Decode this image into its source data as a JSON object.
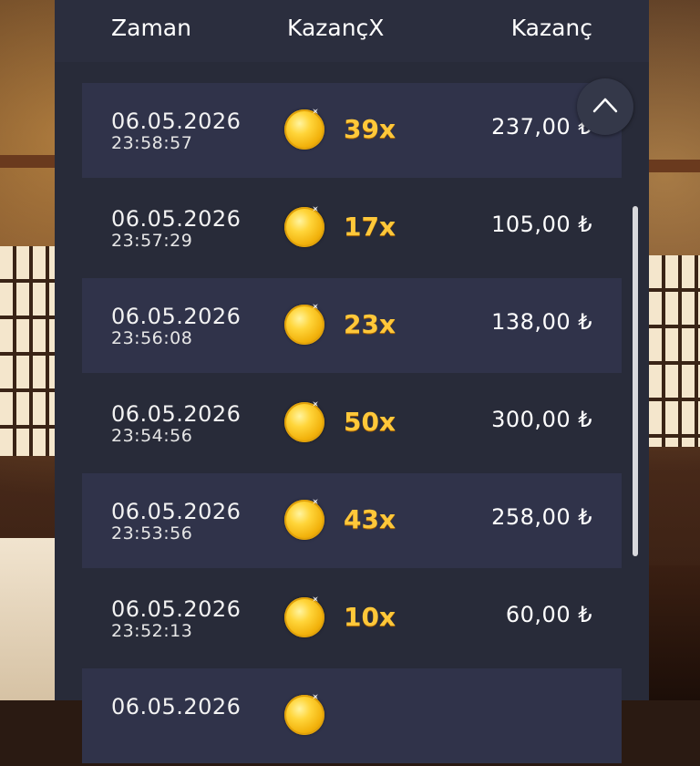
{
  "header": {
    "time_label": "Zaman",
    "multiplier_label": "KazançX",
    "win_label": "Kazanç"
  },
  "rows": [
    {
      "date": "06.05.2026",
      "time": "23:58:57",
      "multiplier": "39x",
      "amount": "237,00 ₺"
    },
    {
      "date": "06.05.2026",
      "time": "23:57:29",
      "multiplier": "17x",
      "amount": "105,00 ₺"
    },
    {
      "date": "06.05.2026",
      "time": "23:56:08",
      "multiplier": "23x",
      "amount": "138,00 ₺"
    },
    {
      "date": "06.05.2026",
      "time": "23:54:56",
      "multiplier": "50x",
      "amount": "300,00 ₺"
    },
    {
      "date": "06.05.2026",
      "time": "23:53:56",
      "multiplier": "43x",
      "amount": "258,00 ₺"
    },
    {
      "date": "06.05.2026",
      "time": "23:52:13",
      "multiplier": "10x",
      "amount": "60,00 ₺"
    },
    {
      "date": "06.05.2026",
      "time": "",
      "multiplier": "",
      "amount": ""
    }
  ],
  "icons": {
    "coin": "gold-coin-icon",
    "scroll_up": "chevron-up-icon"
  },
  "colors": {
    "panel": "#282b39",
    "row_highlight": "#30334a",
    "multiplier": "#ffc83a"
  }
}
